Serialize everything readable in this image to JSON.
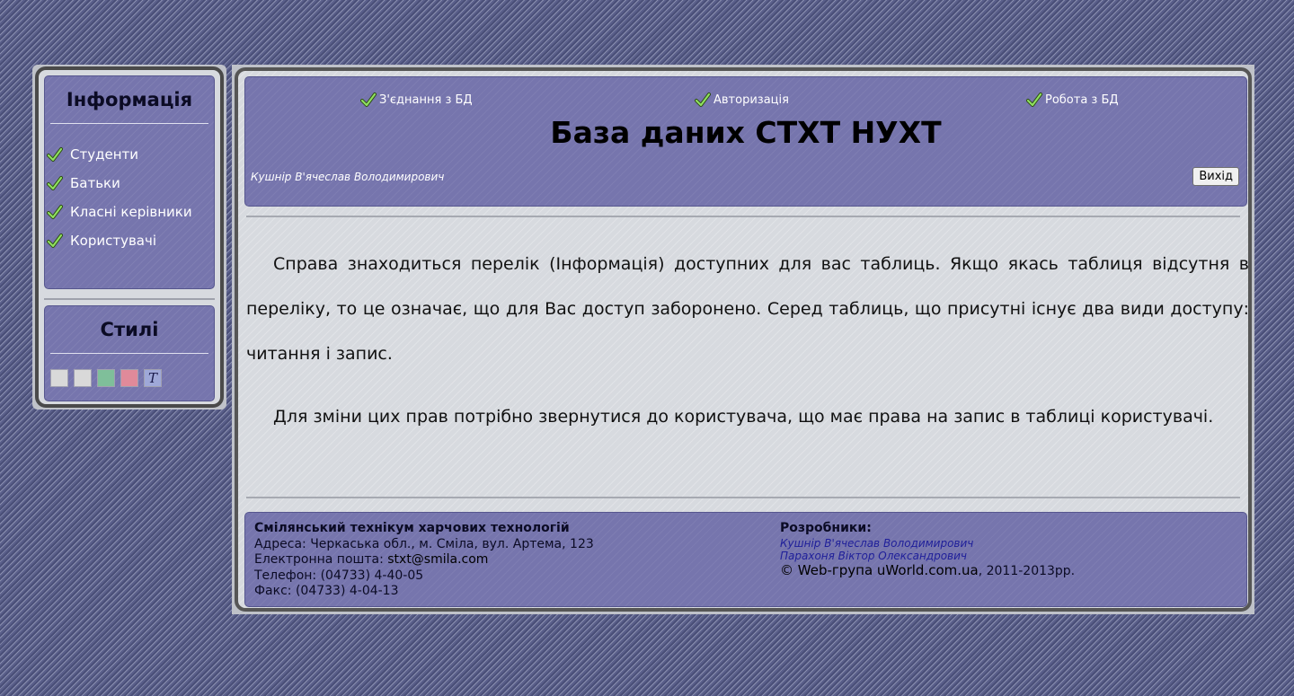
{
  "sidebar": {
    "info_title": "Інформація",
    "items": [
      {
        "label": "Студенти",
        "icon": "check-icon"
      },
      {
        "label": "Батьки",
        "icon": "check-icon"
      },
      {
        "label": "Класні керівники",
        "icon": "check-icon"
      },
      {
        "label": "Користувачі",
        "icon": "check-icon"
      }
    ],
    "styles_title": "Стилі",
    "styles": [
      {
        "color": "#d9d9d9"
      },
      {
        "color": "#d9d9d9"
      },
      {
        "color": "#7fbf9a"
      },
      {
        "color": "#e08a9a"
      },
      {
        "color": "#9fa8d8",
        "glyph": "T"
      }
    ]
  },
  "header": {
    "nav": [
      {
        "label": "З'єднання з БД"
      },
      {
        "label": "Авторизація"
      },
      {
        "label": "Робота з БД"
      }
    ],
    "title": "База даних СТХТ НУХТ",
    "user": "Кушнір В'ячеслав Володимирович",
    "logout_label": "Вихід"
  },
  "content": {
    "paragraphs": [
      "Справа знаходиться перелік (Інформація) доступних для вас таблиць. Якщо якась таблиця відсутня в переліку, то це означає, що для Вас доступ заборонено. Серед таблиць, що присутні існує два види доступу: читання і запис.",
      "Для зміни цих прав потрібно звернутися до користувача, що має права на запис в таблиці користувачі."
    ]
  },
  "footer": {
    "org_name": "Смілянський технікум харчових технологій",
    "address": "Адреса: Черкаська обл., м. Сміла, вул. Артема, 123",
    "email_label": "Електронна пошта: ",
    "email": "stxt@smila.com",
    "phone": "Телефон: (04733) 4-40-05",
    "fax": "Факс: (04733) 4-04-13",
    "dev_title": "Розробники:",
    "developers": [
      "Кушнір В'ячеслав Володимирович",
      "Парахоня Віктор Олександрович"
    ],
    "copyright_group": "© Web-група uWorld.com.ua",
    "copyright_years": ", 2011-2013рр."
  },
  "colors": {
    "panel": "#7675ad",
    "page_bg": "#d7dadf",
    "check_green": "#7fd45a"
  }
}
